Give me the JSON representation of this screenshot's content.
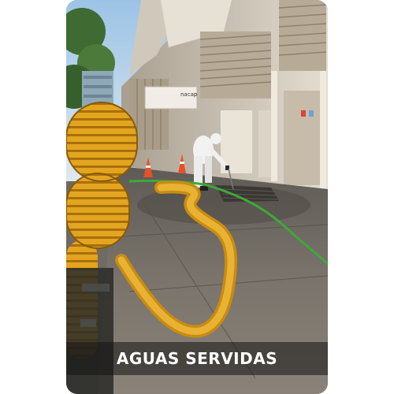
{
  "card": {
    "caption": "AGUAS SERVIDAS",
    "caption_color": "#ffffff",
    "photo_subject": "worker-in-protective-suit-cleaning-drain-with-suction-hoses",
    "building_sign": "nacap",
    "colors": {
      "hose_yellow": "#e0a41c",
      "water_hose_green": "#3fa83a",
      "suit_white": "#f2f2f2",
      "pavement": "#6f6a63",
      "building": "#d9d2c4"
    }
  }
}
